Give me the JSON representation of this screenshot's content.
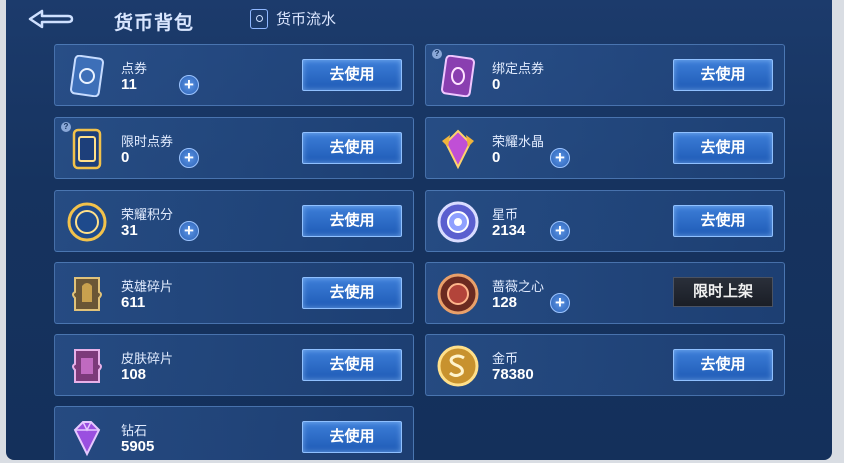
{
  "header": {
    "title": "货币背包",
    "flow_label": "货币流水"
  },
  "cards": [
    {
      "id": "dianquan",
      "name": "点券",
      "value": "11",
      "button": "去使用",
      "plus": true,
      "help": false
    },
    {
      "id": "bangding",
      "name": "绑定点券",
      "value": "0",
      "button": "去使用",
      "plus": false,
      "help": true
    },
    {
      "id": "xianshi",
      "name": "限时点券",
      "value": "0",
      "button": "去使用",
      "plus": true,
      "help": true
    },
    {
      "id": "shuijing",
      "name": "荣耀水晶",
      "value": "0",
      "button": "去使用",
      "plus": true,
      "help": false
    },
    {
      "id": "jifen",
      "name": "荣耀积分",
      "value": "31",
      "button": "去使用",
      "plus": true,
      "help": false
    },
    {
      "id": "xingbi",
      "name": "星币",
      "value": "2134",
      "button": "去使用",
      "plus": true,
      "help": false
    },
    {
      "id": "yingxiong",
      "name": "英雄碎片",
      "value": "611",
      "button": "去使用",
      "plus": false,
      "help": false
    },
    {
      "id": "qiangwei",
      "name": "蔷薇之心",
      "value": "128",
      "button": "限时上架",
      "plus": true,
      "help": false
    },
    {
      "id": "pifu",
      "name": "皮肤碎片",
      "value": "108",
      "button": "去使用",
      "plus": false,
      "help": false
    },
    {
      "id": "jinbi",
      "name": "金币",
      "value": "78380",
      "button": "去使用",
      "plus": false,
      "help": false
    },
    {
      "id": "zuanshi",
      "name": "钻石",
      "value": "5905",
      "button": "去使用",
      "plus": false,
      "help": false
    }
  ],
  "icons": {
    "back": "back-arrow-icon",
    "flow": "ledger-icon"
  },
  "colors": {
    "panel": "#16335f",
    "button": "#2b6cc7",
    "limited": "#22262f"
  }
}
